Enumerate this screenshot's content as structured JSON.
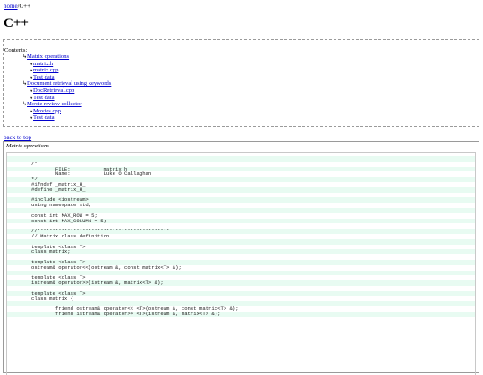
{
  "breadcrumb": {
    "home": "home",
    "separator": "/",
    "current": "C++"
  },
  "page_title": "C++",
  "contents": {
    "label": "Contents:",
    "items": [
      {
        "text": "Matrix operations",
        "level": 1
      },
      {
        "text": "matrix.h",
        "level": 2
      },
      {
        "text": "matrix.cpp",
        "level": 2
      },
      {
        "text": "Test data",
        "level": 2
      },
      {
        "text": "Document retrieval using keywords",
        "level": 1
      },
      {
        "text": "DocRetrieval.cpp",
        "level": 2
      },
      {
        "text": "Test data",
        "level": 2
      },
      {
        "text": "Movie review collector",
        "level": 1
      },
      {
        "text": "Movies.cpp",
        "level": 2
      },
      {
        "text": "Test data",
        "level": 2
      }
    ]
  },
  "back_to_top": "back to top",
  "section": {
    "title": "Matrix operations",
    "code_lines": [
      "",
      "/*",
      "        FILE:           matrix.h",
      "        Name:           Luke O'Callaghan",
      "*/",
      "#ifndef _matrix_H_",
      "#define _matrix_H_",
      "",
      "#include <iostream>",
      "using namespace std;",
      "",
      "const int MAX_ROW = 5;",
      "const int MAX_COLUMN = 5;",
      "",
      "//********************************************",
      "// Matrix class definition.",
      "",
      "template <class T>",
      "class matrix;",
      "",
      "template <class T>",
      "ostream& operator<<(ostream &, const matrix<T> &);",
      "",
      "template <class T>",
      "istream& operator>>(istream &, matrix<T> &);",
      "",
      "template <class T>",
      "class matrix {",
      "",
      "        friend ostream& operator<< <T>(ostream &, const matrix<T> &);",
      "        friend istream& operator>> <T>(istream &, matrix<T> &);"
    ]
  }
}
